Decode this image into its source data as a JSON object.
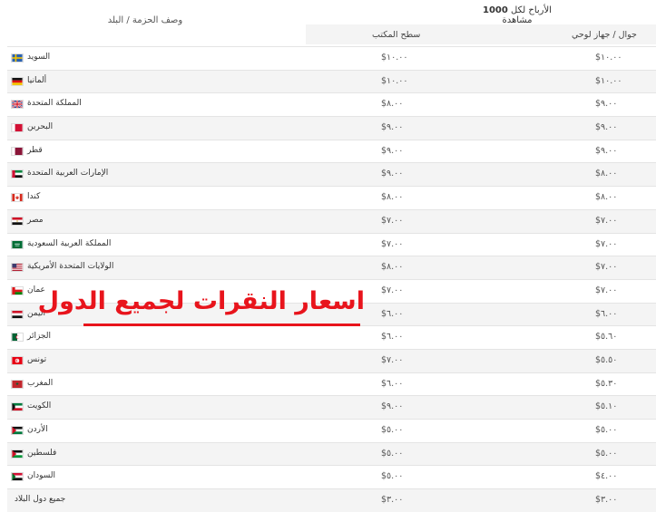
{
  "header": {
    "country_col": "وصف الحزمة / البلد",
    "earnings_prefix": "الأرباح لكل",
    "earnings_count": "1000",
    "earnings_suffix": "مشاهدة",
    "desktop_col": "سطح المكتب",
    "mobile_col": "جوال / جهاز لوحي"
  },
  "overlay_title": "اسعار النقرات لجميع الدول",
  "rows": [
    {
      "country": "السويد",
      "flag": "sweden-flag-icon",
      "desktop": "$١٠.٠٠",
      "mobile": "$١٠.٠٠"
    },
    {
      "country": "ألمانيا",
      "flag": "germany-flag-icon",
      "desktop": "$١٠.٠٠",
      "mobile": "$١٠.٠٠"
    },
    {
      "country": "المملكة المتحدة",
      "flag": "uk-flag-icon",
      "desktop": "$٨.٠٠",
      "mobile": "$٩.٠٠"
    },
    {
      "country": "البحرين",
      "flag": "bahrain-flag-icon",
      "desktop": "$٩.٠٠",
      "mobile": "$٩.٠٠"
    },
    {
      "country": "قطر",
      "flag": "qatar-flag-icon",
      "desktop": "$٩.٠٠",
      "mobile": "$٩.٠٠"
    },
    {
      "country": "الإمارات العربية المتحدة",
      "flag": "uae-flag-icon",
      "desktop": "$٩.٠٠",
      "mobile": "$٨.٠٠"
    },
    {
      "country": "كندا",
      "flag": "canada-flag-icon",
      "desktop": "$٨.٠٠",
      "mobile": "$٨.٠٠"
    },
    {
      "country": "مصر",
      "flag": "egypt-flag-icon",
      "desktop": "$٧.٠٠",
      "mobile": "$٧.٠٠"
    },
    {
      "country": "المملكة العربية السعودية",
      "flag": "saudi-flag-icon",
      "desktop": "$٧.٠٠",
      "mobile": "$٧.٠٠"
    },
    {
      "country": "الولايات المتحدة الأمريكية",
      "flag": "usa-flag-icon",
      "desktop": "$٨.٠٠",
      "mobile": "$٧.٠٠"
    },
    {
      "country": "عمان",
      "flag": "oman-flag-icon",
      "desktop": "$٧.٠٠",
      "mobile": "$٧.٠٠"
    },
    {
      "country": "اليمن",
      "flag": "yemen-flag-icon",
      "desktop": "$٦.٠٠",
      "mobile": "$٦.٠٠"
    },
    {
      "country": "الجزائر",
      "flag": "algeria-flag-icon",
      "desktop": "$٦.٠٠",
      "mobile": "$٥.٦٠"
    },
    {
      "country": "تونس",
      "flag": "tunisia-flag-icon",
      "desktop": "$٧.٠٠",
      "mobile": "$٥.٥٠"
    },
    {
      "country": "المغرب",
      "flag": "morocco-flag-icon",
      "desktop": "$٦.٠٠",
      "mobile": "$٥.٣٠"
    },
    {
      "country": "الكويت",
      "flag": "kuwait-flag-icon",
      "desktop": "$٩.٠٠",
      "mobile": "$٥.١٠"
    },
    {
      "country": "الأردن",
      "flag": "jordan-flag-icon",
      "desktop": "$٥.٠٠",
      "mobile": "$٥.٠٠"
    },
    {
      "country": "فلسطين",
      "flag": "palestine-flag-icon",
      "desktop": "$٥.٠٠",
      "mobile": "$٥.٠٠"
    },
    {
      "country": "السودان",
      "flag": "sudan-flag-icon",
      "desktop": "$٥.٠٠",
      "mobile": "$٤.٠٠"
    },
    {
      "country": "جميع دول البلاد",
      "flag": "",
      "desktop": "$٣.٠٠",
      "mobile": "$٣.٠٠"
    }
  ]
}
